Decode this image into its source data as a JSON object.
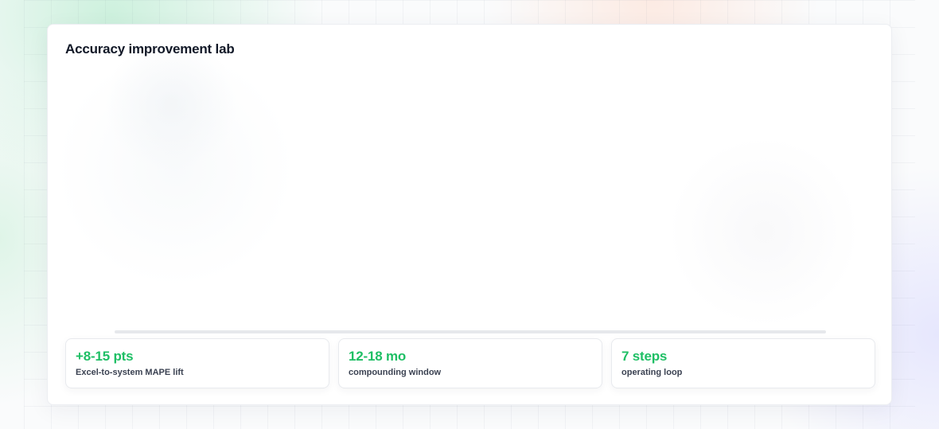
{
  "panel": {
    "title": "Accuracy improvement lab"
  },
  "stats": [
    {
      "value": "+8-15 pts",
      "label": "Excel-to-system MAPE lift"
    },
    {
      "value": "12-18 mo",
      "label": "compounding window"
    },
    {
      "value": "7 steps",
      "label": "operating loop"
    }
  ],
  "colors": {
    "accent": "#1fbf65",
    "title": "#111827",
    "label": "#3b4252"
  }
}
